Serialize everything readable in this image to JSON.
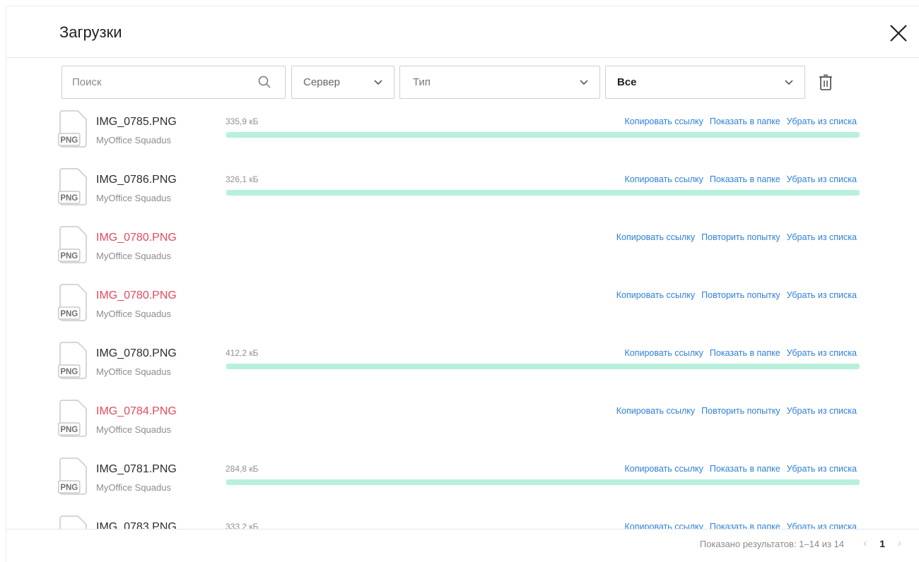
{
  "dialog": {
    "title": "Загрузки"
  },
  "toolbar": {
    "search_placeholder": "Поиск",
    "server_label": "Сервер",
    "type_label": "Тип",
    "status_label": "Все"
  },
  "file_icon_label": "PNG",
  "items": [
    {
      "name": "IMG_0785.PNG",
      "source": "MyOffice Squadus",
      "size": "335,9 кБ",
      "status": "done",
      "progress_percent": 100,
      "actions": [
        "Копировать ссылку",
        "Показать в папке",
        "Убрать из списка"
      ]
    },
    {
      "name": "IMG_0786.PNG",
      "source": "MyOffice Squadus",
      "size": "326,1 кБ",
      "status": "done",
      "progress_percent": 100,
      "actions": [
        "Копировать ссылку",
        "Показать в папке",
        "Убрать из списка"
      ]
    },
    {
      "name": "IMG_0780.PNG",
      "source": "MyOffice Squadus",
      "size": "",
      "status": "error",
      "actions": [
        "Копировать ссылку",
        "Повторить попытку",
        "Убрать из списка"
      ]
    },
    {
      "name": "IMG_0780.PNG",
      "source": "MyOffice Squadus",
      "size": "",
      "status": "error",
      "actions": [
        "Копировать ссылку",
        "Повторить попытку",
        "Убрать из списка"
      ]
    },
    {
      "name": "IMG_0780.PNG",
      "source": "MyOffice Squadus",
      "size": "412,2 кБ",
      "status": "done",
      "progress_percent": 100,
      "actions": [
        "Копировать ссылку",
        "Показать в папке",
        "Убрать из списка"
      ]
    },
    {
      "name": "IMG_0784.PNG",
      "source": "MyOffice Squadus",
      "size": "",
      "status": "error",
      "actions": [
        "Копировать ссылку",
        "Повторить попытку",
        "Убрать из списка"
      ]
    },
    {
      "name": "IMG_0781.PNG",
      "source": "MyOffice Squadus",
      "size": "284,8 кБ",
      "status": "done",
      "progress_percent": 100,
      "actions": [
        "Копировать ссылку",
        "Показать в папке",
        "Убрать из списка"
      ]
    },
    {
      "name": "IMG_0783.PNG",
      "source": "MyOffice Squadus",
      "size": "333,2 кБ",
      "status": "done",
      "progress_percent": 100,
      "actions": [
        "Копировать ссылку",
        "Показать в папке",
        "Убрать из списка"
      ]
    }
  ],
  "footer": {
    "results_text": "Показано результатов: 1–14 из 14",
    "current_page": "1",
    "prev_icon": "chevron-left-icon",
    "next_icon": "chevron-right-icon"
  },
  "colors": {
    "link": "#2f80d8",
    "error": "#e5485d",
    "progress": "#b8f0dc"
  }
}
